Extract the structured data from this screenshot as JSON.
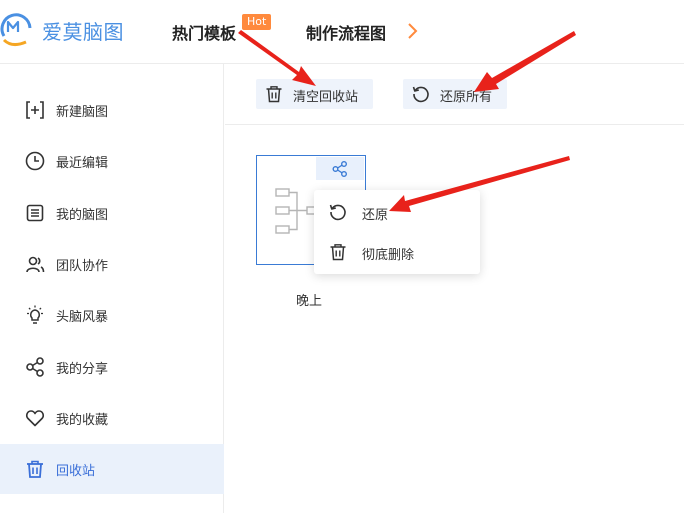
{
  "header": {
    "logo_text": "爱莫脑图",
    "nav": [
      {
        "label": "热门模板",
        "badge": "Hot"
      },
      {
        "label": "制作流程图"
      }
    ]
  },
  "sidebar": {
    "items": [
      {
        "label": "新建脑图",
        "icon": "add-box-icon"
      },
      {
        "label": "最近编辑",
        "icon": "clock-icon"
      },
      {
        "label": "我的脑图",
        "icon": "document-list-icon"
      },
      {
        "label": "团队协作",
        "icon": "team-icon"
      },
      {
        "label": "头脑风暴",
        "icon": "lightbulb-icon"
      },
      {
        "label": "我的分享",
        "icon": "share-icon"
      },
      {
        "label": "我的收藏",
        "icon": "heart-icon"
      },
      {
        "label": "回收站",
        "icon": "trash-icon",
        "active": true
      }
    ]
  },
  "toolbar": {
    "clear_label": "清空回收站",
    "restore_all_label": "还原所有"
  },
  "card": {
    "title": "晚上"
  },
  "context_menu": {
    "restore_label": "还原",
    "delete_label": "彻底删除"
  },
  "colors": {
    "accent": "#3a7bd5",
    "annotation": "#e8221b",
    "hot_badge": "#ff8a3d",
    "active_bg": "#eaf1fb"
  }
}
